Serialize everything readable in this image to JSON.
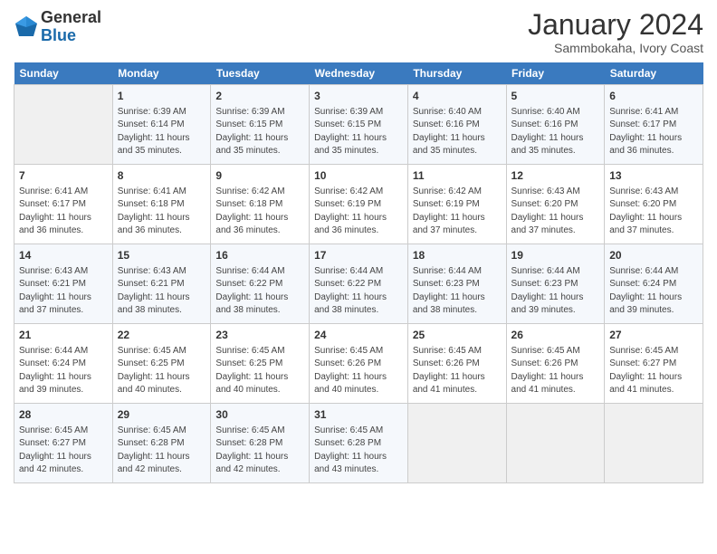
{
  "header": {
    "logo": {
      "line1": "General",
      "line2": "Blue"
    },
    "title": "January 2024",
    "subtitle": "Sammbokaha, Ivory Coast"
  },
  "days_of_week": [
    "Sunday",
    "Monday",
    "Tuesday",
    "Wednesday",
    "Thursday",
    "Friday",
    "Saturday"
  ],
  "weeks": [
    [
      {
        "day": "",
        "info": ""
      },
      {
        "day": "1",
        "info": "Sunrise: 6:39 AM\nSunset: 6:14 PM\nDaylight: 11 hours\nand 35 minutes."
      },
      {
        "day": "2",
        "info": "Sunrise: 6:39 AM\nSunset: 6:15 PM\nDaylight: 11 hours\nand 35 minutes."
      },
      {
        "day": "3",
        "info": "Sunrise: 6:39 AM\nSunset: 6:15 PM\nDaylight: 11 hours\nand 35 minutes."
      },
      {
        "day": "4",
        "info": "Sunrise: 6:40 AM\nSunset: 6:16 PM\nDaylight: 11 hours\nand 35 minutes."
      },
      {
        "day": "5",
        "info": "Sunrise: 6:40 AM\nSunset: 6:16 PM\nDaylight: 11 hours\nand 35 minutes."
      },
      {
        "day": "6",
        "info": "Sunrise: 6:41 AM\nSunset: 6:17 PM\nDaylight: 11 hours\nand 36 minutes."
      }
    ],
    [
      {
        "day": "7",
        "info": "Sunrise: 6:41 AM\nSunset: 6:17 PM\nDaylight: 11 hours\nand 36 minutes."
      },
      {
        "day": "8",
        "info": "Sunrise: 6:41 AM\nSunset: 6:18 PM\nDaylight: 11 hours\nand 36 minutes."
      },
      {
        "day": "9",
        "info": "Sunrise: 6:42 AM\nSunset: 6:18 PM\nDaylight: 11 hours\nand 36 minutes."
      },
      {
        "day": "10",
        "info": "Sunrise: 6:42 AM\nSunset: 6:19 PM\nDaylight: 11 hours\nand 36 minutes."
      },
      {
        "day": "11",
        "info": "Sunrise: 6:42 AM\nSunset: 6:19 PM\nDaylight: 11 hours\nand 37 minutes."
      },
      {
        "day": "12",
        "info": "Sunrise: 6:43 AM\nSunset: 6:20 PM\nDaylight: 11 hours\nand 37 minutes."
      },
      {
        "day": "13",
        "info": "Sunrise: 6:43 AM\nSunset: 6:20 PM\nDaylight: 11 hours\nand 37 minutes."
      }
    ],
    [
      {
        "day": "14",
        "info": "Sunrise: 6:43 AM\nSunset: 6:21 PM\nDaylight: 11 hours\nand 37 minutes."
      },
      {
        "day": "15",
        "info": "Sunrise: 6:43 AM\nSunset: 6:21 PM\nDaylight: 11 hours\nand 38 minutes."
      },
      {
        "day": "16",
        "info": "Sunrise: 6:44 AM\nSunset: 6:22 PM\nDaylight: 11 hours\nand 38 minutes."
      },
      {
        "day": "17",
        "info": "Sunrise: 6:44 AM\nSunset: 6:22 PM\nDaylight: 11 hours\nand 38 minutes."
      },
      {
        "day": "18",
        "info": "Sunrise: 6:44 AM\nSunset: 6:23 PM\nDaylight: 11 hours\nand 38 minutes."
      },
      {
        "day": "19",
        "info": "Sunrise: 6:44 AM\nSunset: 6:23 PM\nDaylight: 11 hours\nand 39 minutes."
      },
      {
        "day": "20",
        "info": "Sunrise: 6:44 AM\nSunset: 6:24 PM\nDaylight: 11 hours\nand 39 minutes."
      }
    ],
    [
      {
        "day": "21",
        "info": "Sunrise: 6:44 AM\nSunset: 6:24 PM\nDaylight: 11 hours\nand 39 minutes."
      },
      {
        "day": "22",
        "info": "Sunrise: 6:45 AM\nSunset: 6:25 PM\nDaylight: 11 hours\nand 40 minutes."
      },
      {
        "day": "23",
        "info": "Sunrise: 6:45 AM\nSunset: 6:25 PM\nDaylight: 11 hours\nand 40 minutes."
      },
      {
        "day": "24",
        "info": "Sunrise: 6:45 AM\nSunset: 6:26 PM\nDaylight: 11 hours\nand 40 minutes."
      },
      {
        "day": "25",
        "info": "Sunrise: 6:45 AM\nSunset: 6:26 PM\nDaylight: 11 hours\nand 41 minutes."
      },
      {
        "day": "26",
        "info": "Sunrise: 6:45 AM\nSunset: 6:26 PM\nDaylight: 11 hours\nand 41 minutes."
      },
      {
        "day": "27",
        "info": "Sunrise: 6:45 AM\nSunset: 6:27 PM\nDaylight: 11 hours\nand 41 minutes."
      }
    ],
    [
      {
        "day": "28",
        "info": "Sunrise: 6:45 AM\nSunset: 6:27 PM\nDaylight: 11 hours\nand 42 minutes."
      },
      {
        "day": "29",
        "info": "Sunrise: 6:45 AM\nSunset: 6:28 PM\nDaylight: 11 hours\nand 42 minutes."
      },
      {
        "day": "30",
        "info": "Sunrise: 6:45 AM\nSunset: 6:28 PM\nDaylight: 11 hours\nand 42 minutes."
      },
      {
        "day": "31",
        "info": "Sunrise: 6:45 AM\nSunset: 6:28 PM\nDaylight: 11 hours\nand 43 minutes."
      },
      {
        "day": "",
        "info": ""
      },
      {
        "day": "",
        "info": ""
      },
      {
        "day": "",
        "info": ""
      }
    ]
  ]
}
